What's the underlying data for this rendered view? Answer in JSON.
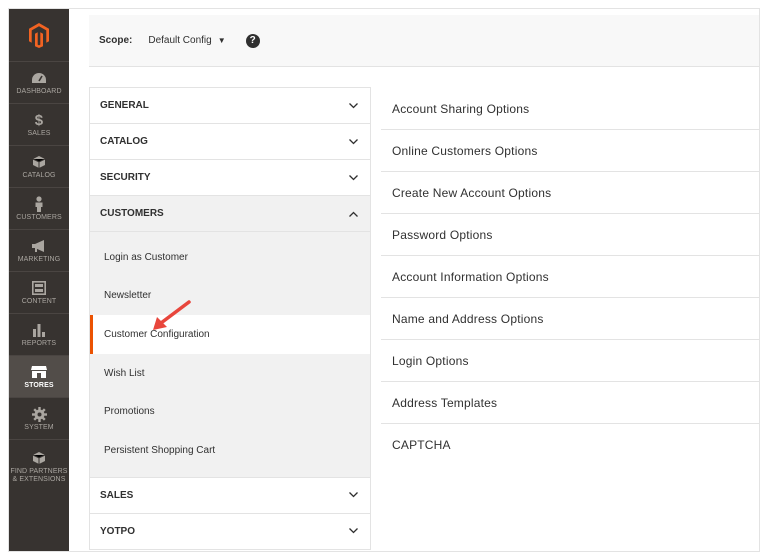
{
  "sidebar": {
    "items": [
      {
        "label": "DASHBOARD",
        "icon": "dashboard-icon"
      },
      {
        "label": "SALES",
        "icon": "dollar-icon"
      },
      {
        "label": "CATALOG",
        "icon": "box-icon"
      },
      {
        "label": "CUSTOMERS",
        "icon": "person-icon"
      },
      {
        "label": "MARKETING",
        "icon": "megaphone-icon"
      },
      {
        "label": "CONTENT",
        "icon": "content-icon"
      },
      {
        "label": "REPORTS",
        "icon": "bar-chart-icon"
      },
      {
        "label": "STORES",
        "icon": "store-icon",
        "active": true
      },
      {
        "label": "SYSTEM",
        "icon": "gear-icon"
      },
      {
        "label": "FIND PARTNERS & EXTENSIONS",
        "icon": "partners-box-icon"
      }
    ]
  },
  "header": {
    "scope_label": "Scope:",
    "scope_value": "Default Config",
    "help": "?"
  },
  "tabs": [
    {
      "label": "GENERAL"
    },
    {
      "label": "CATALOG"
    },
    {
      "label": "SECURITY"
    },
    {
      "label": "CUSTOMERS",
      "open": true,
      "items": [
        "Login as Customer",
        "Newsletter",
        "Customer Configuration",
        "Wish List",
        "Promotions",
        "Persistent Shopping Cart"
      ],
      "active_item": "Customer Configuration"
    },
    {
      "label": "SALES"
    },
    {
      "label": "YOTPO"
    }
  ],
  "options": [
    "Account Sharing Options",
    "Online Customers Options",
    "Create New Account Options",
    "Password Options",
    "Account Information Options",
    "Name and Address Options",
    "Login Options",
    "Address Templates",
    "CAPTCHA"
  ],
  "colors": {
    "sidebar_bg": "#373330",
    "accent": "#eb5202",
    "arrow": "#e8463c"
  }
}
